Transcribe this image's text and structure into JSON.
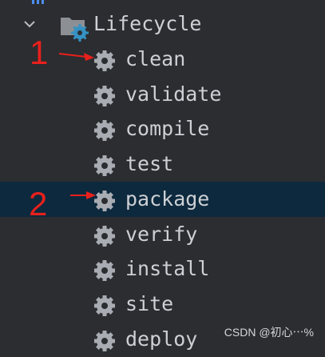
{
  "tree": {
    "root": {
      "label": "Lifecycle",
      "icon": "maven-lifecycle-folder-icon",
      "expanded": true
    },
    "items": [
      {
        "label": "clean",
        "icon": "gear-icon",
        "selected": false
      },
      {
        "label": "validate",
        "icon": "gear-icon",
        "selected": false
      },
      {
        "label": "compile",
        "icon": "gear-icon",
        "selected": false
      },
      {
        "label": "test",
        "icon": "gear-icon",
        "selected": false
      },
      {
        "label": "package",
        "icon": "gear-icon",
        "selected": true
      },
      {
        "label": "verify",
        "icon": "gear-icon",
        "selected": false
      },
      {
        "label": "install",
        "icon": "gear-icon",
        "selected": false
      },
      {
        "label": "site",
        "icon": "gear-icon",
        "selected": false
      },
      {
        "label": "deploy",
        "icon": "gear-icon",
        "selected": false
      }
    ]
  },
  "annotations": [
    {
      "number": "1",
      "points_to": "clean"
    },
    {
      "number": "2",
      "points_to": "package"
    }
  ],
  "watermark": "CSDN @初心⋯%",
  "colors": {
    "background": "#2b2d30",
    "selected_row": "#0d293e",
    "text": "#cdd0d4",
    "icon": "#a9adb3",
    "annotation": "#e8201c",
    "gear_badge": "#3592c4"
  }
}
